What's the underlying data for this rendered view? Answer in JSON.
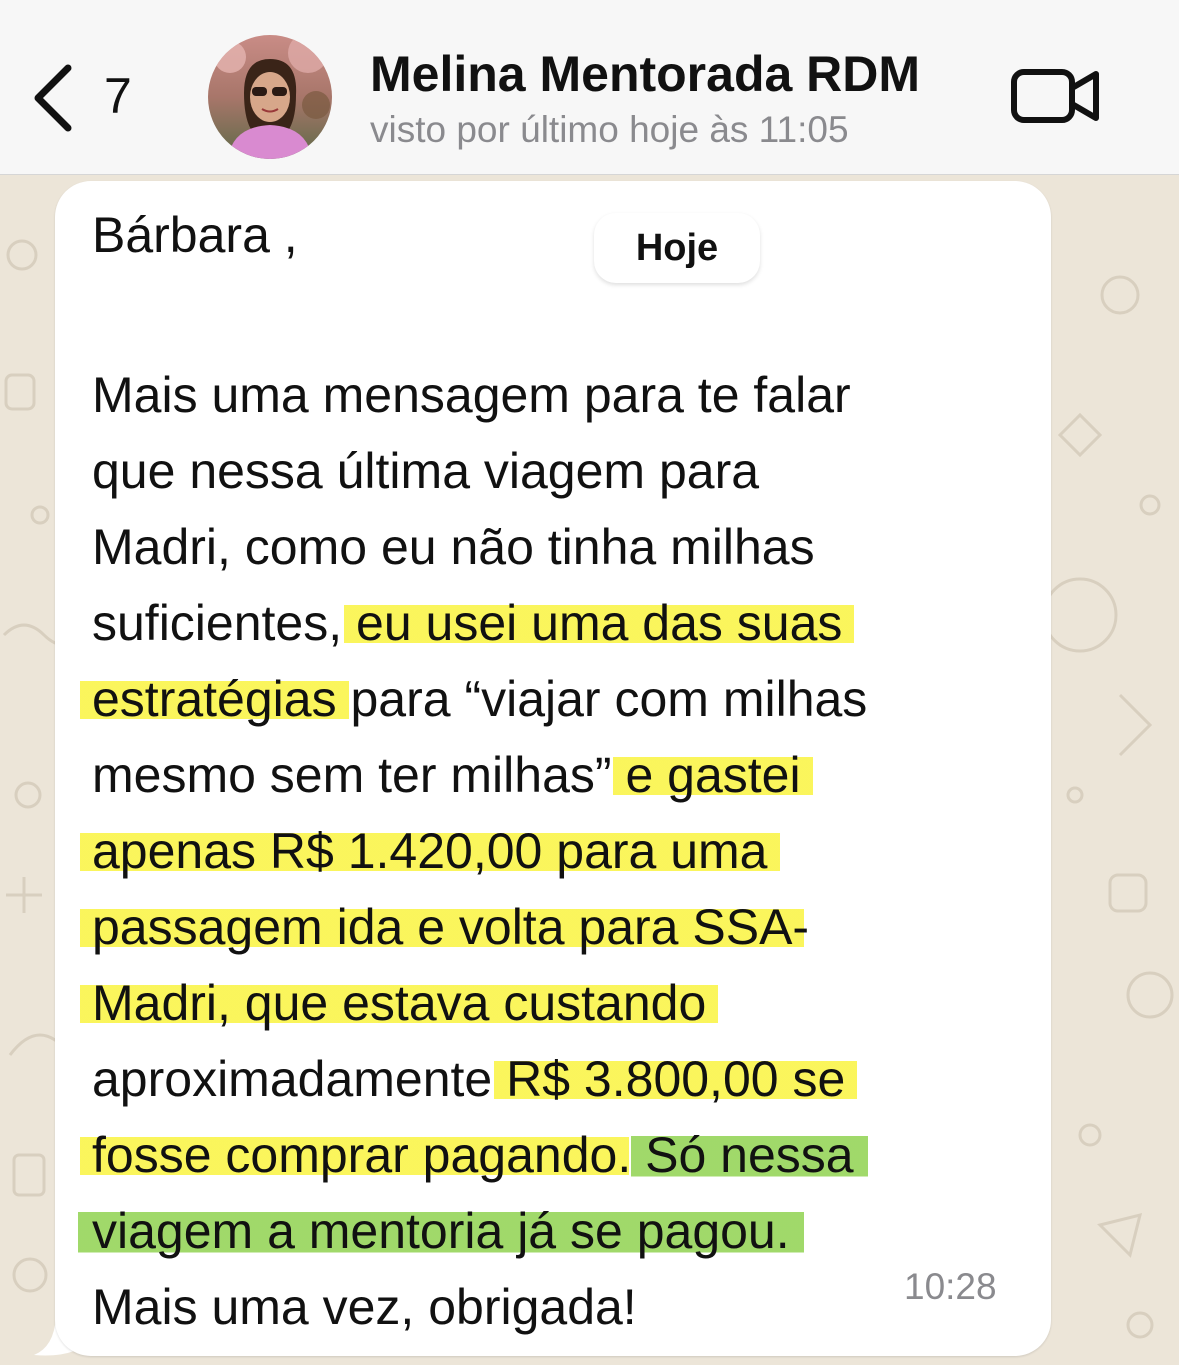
{
  "header": {
    "unread_count": "7",
    "contact_name": "Melina Mentorada RDM",
    "last_seen": "visto por último hoje às 11:05"
  },
  "chat": {
    "date_label": "Hoje",
    "message": {
      "greeting": "Bárbara ,",
      "lines": [
        [
          "Mais uma mensagem para te falar"
        ],
        [
          "que nessa última viagem para"
        ],
        [
          "Madri, como eu não tinha milhas"
        ],
        [
          "suficientes, ",
          "eu usei uma das suas"
        ],
        [
          "estratégias",
          " para “viajar com milhas"
        ],
        [
          "mesmo sem ter milhas” ",
          "e gastei"
        ],
        [
          "apenas R$ 1.420,00 para uma"
        ],
        [
          "passagem ida e volta para SSA",
          "-"
        ],
        [
          "Madri, que estava custando"
        ],
        [
          "aproximadamente ",
          "R$ 3.800,00 se"
        ],
        [
          "fosse comprar pagando",
          ". ",
          "Só nessa"
        ],
        [
          "viagem a mentoria já se pagou."
        ],
        [
          "Mais uma vez, obrigada!"
        ]
      ],
      "time": "10:28"
    }
  },
  "colors": {
    "highlight_yellow": "#f8f236",
    "highlight_green": "#86ce40",
    "header_bg": "#f7f7f7",
    "wallpaper_bg": "#ece5d8",
    "secondary_text": "#8a8a8e"
  },
  "icons": {
    "back": "chevron-left-icon",
    "video": "video-camera-icon"
  }
}
